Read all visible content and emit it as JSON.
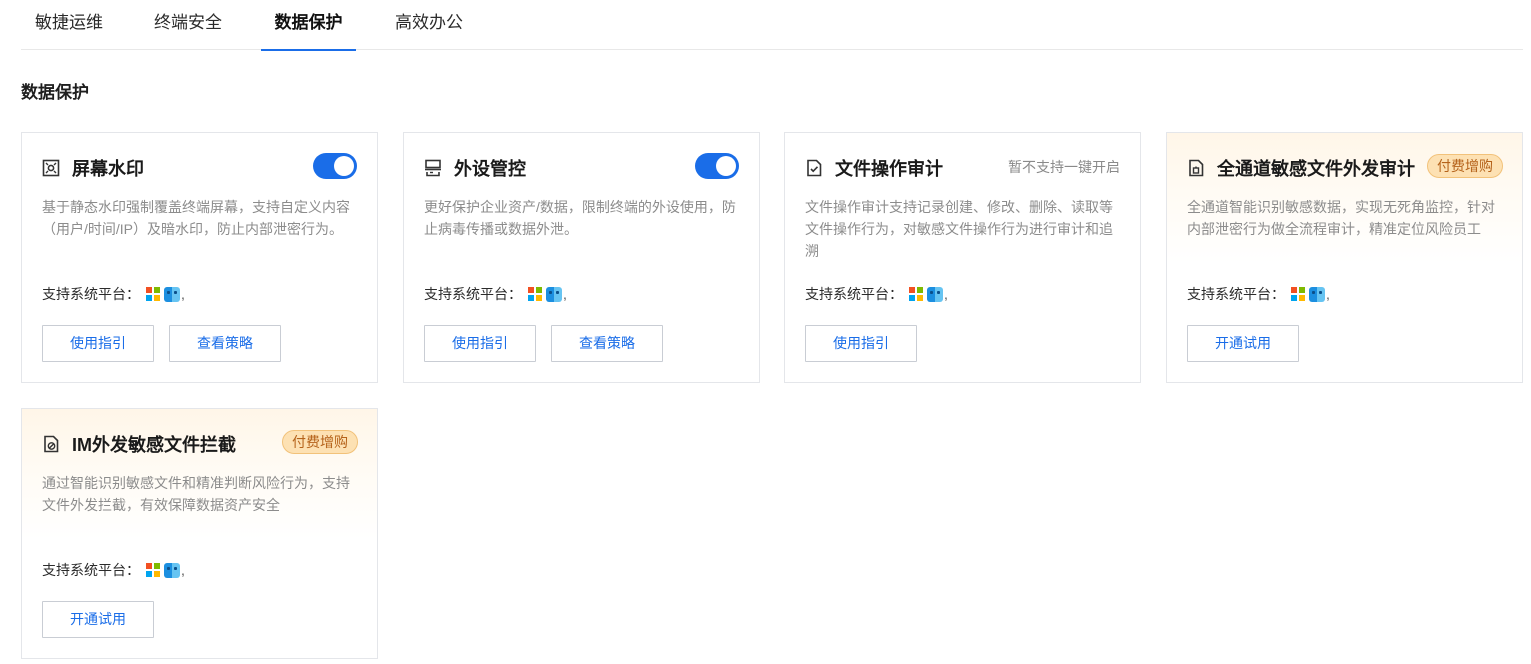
{
  "tabs": [
    {
      "label": "敏捷运维",
      "active": false
    },
    {
      "label": "终端安全",
      "active": false
    },
    {
      "label": "数据保护",
      "active": true
    },
    {
      "label": "高效办公",
      "active": false
    }
  ],
  "section_title": "数据保护",
  "platform_label": "支持系统平台：",
  "platform_suffix": ",",
  "cards": [
    {
      "title": "屏幕水印",
      "icon": "watermark-icon",
      "toggle_on": true,
      "desc": "基于静态水印强制覆盖终端屏幕，支持自定义内容（用户/时间/IP）及暗水印，防止内部泄密行为。",
      "buttons": [
        "使用指引",
        "查看策略"
      ]
    },
    {
      "title": "外设管控",
      "icon": "peripheral-icon",
      "toggle_on": true,
      "desc": "更好保护企业资产/数据，限制终端的外设使用，防止病毒传播或数据外泄。",
      "buttons": [
        "使用指引",
        "查看策略"
      ]
    },
    {
      "title": "文件操作审计",
      "icon": "file-audit-icon",
      "note": "暂不支持一键开启",
      "desc": "文件操作审计支持记录创建、修改、删除、读取等文件操作行为，对敏感文件操作行为进行审计和追溯",
      "buttons": [
        "使用指引"
      ]
    },
    {
      "title": "全通道敏感文件外发审计",
      "icon": "sensitive-file-icon",
      "badge": "付费增购",
      "desc": "全通道智能识别敏感数据，实现无死角监控，针对内部泄密行为做全流程审计，精准定位风险员工",
      "buttons": [
        "开通试用"
      ]
    },
    {
      "title": "IM外发敏感文件拦截",
      "icon": "im-block-icon",
      "badge": "付费增购",
      "desc": "通过智能识别敏感文件和精准判断风险行为，支持文件外发拦截，有效保障数据资产安全",
      "buttons": [
        "开通试用"
      ]
    }
  ],
  "colors": {
    "accent": "#1a6de8",
    "badge_bg": "#fde1b3",
    "badge_text": "#b5621a",
    "desc_text": "#8c8c8c"
  }
}
